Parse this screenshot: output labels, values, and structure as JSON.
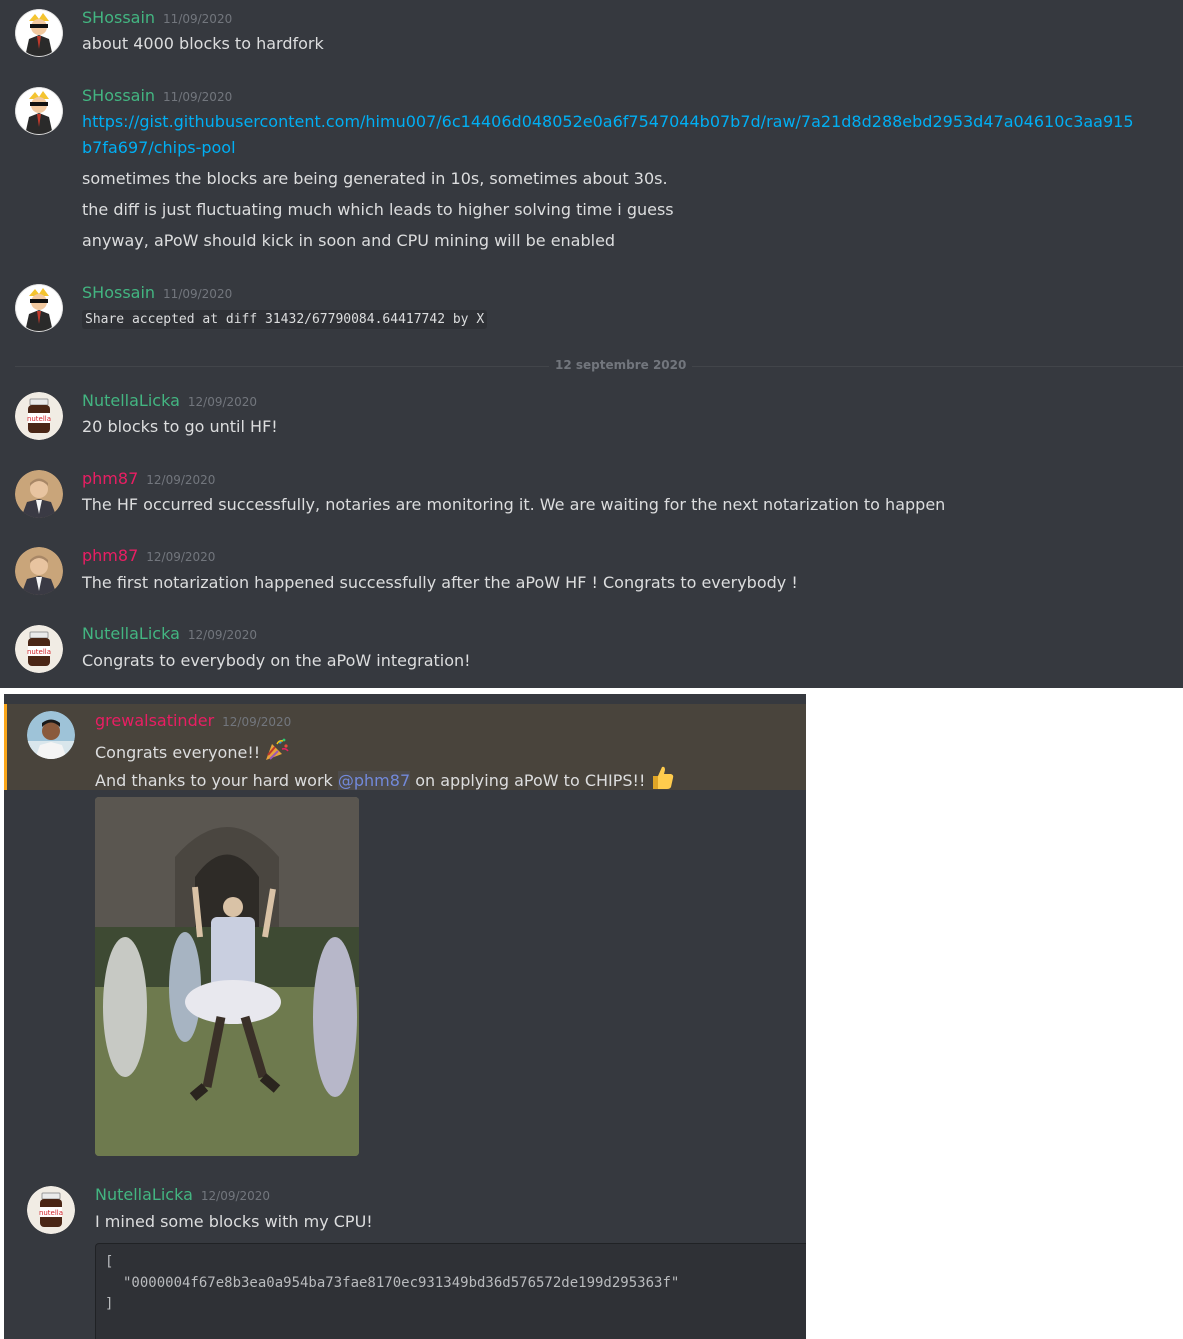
{
  "colors": {
    "background": "#36393f",
    "text": "#dcddde",
    "muted": "#72767d",
    "link": "#00aff4",
    "green_user": "#43b581",
    "pink_user": "#e91e63",
    "mention": "#7289da",
    "highlight_bar": "#faa61a"
  },
  "top_messages": [
    {
      "username": "SHossain",
      "timestamp": "11/09/2020",
      "lines": [
        "about 4000 blocks to hardfork"
      ]
    },
    {
      "username": "SHossain",
      "timestamp": "11/09/2020",
      "link_lines": [
        "https://gist.githubusercontent.com/himu007/6c14406d048052e0a6f7547044b07b7d/raw/7a21d8d288ebd2953d47a04610c3aa915",
        "b7fa697/chips-pool"
      ],
      "lines": [
        "sometimes the blocks are being generated in 10s, sometimes about 30s.",
        "the diff is just fluctuating much which leads to higher solving time i guess",
        "anyway, aPoW should kick in soon and CPU mining will be enabled"
      ]
    },
    {
      "username": "SHossain",
      "timestamp": "11/09/2020",
      "code": "Share accepted at diff 31432/67790084.64417742 by X"
    },
    {
      "username": "NutellaLicka",
      "timestamp": "12/09/2020",
      "lines": [
        "20 blocks to go until HF!"
      ]
    },
    {
      "username": "phm87",
      "timestamp": "12/09/2020",
      "lines": [
        "The HF occurred successfully, notaries are monitoring it. We are waiting for the next notarization to happen"
      ]
    },
    {
      "username": "phm87",
      "timestamp": "12/09/2020",
      "lines": [
        "The first notarization happened successfully after the aPoW HF ! Congrats to everybody !"
      ]
    },
    {
      "username": "NutellaLicka",
      "timestamp": "12/09/2020",
      "lines": [
        "Congrats to everybody on the aPoW integration!"
      ]
    }
  ],
  "date_divider": "12 septembre 2020",
  "bottom_messages": {
    "first": {
      "username": "grewalsatinder",
      "timestamp": "12/09/2020",
      "line1": "Congrats everyone!!",
      "line2_before": "And thanks to your hard work ",
      "mention": "@phm87",
      "line2_after": " on applying aPoW to CHIPS!!",
      "emoji1": "party-popper-icon",
      "emoji2": "thumbs-up-icon"
    },
    "second": {
      "username": "NutellaLicka",
      "timestamp": "12/09/2020",
      "text": "I mined some blocks with my CPU!",
      "code_open": "[",
      "code_value": "\"0000004f67e8b3ea0a954ba73fae8170ec931349bd36d576572de199d295363f\"",
      "code_close": "]"
    }
  }
}
